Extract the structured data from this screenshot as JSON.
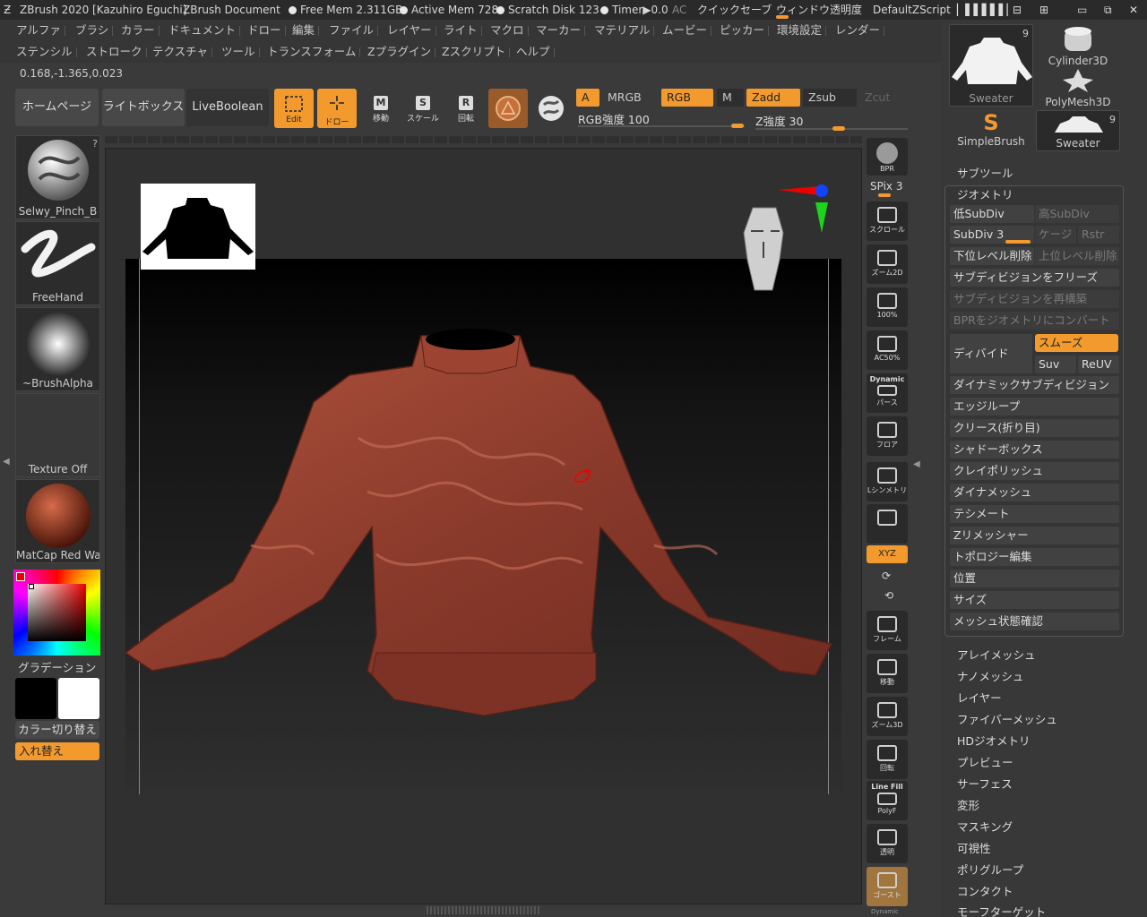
{
  "titlebar": {
    "app": "ZBrush 2020 [Kazuhiro Eguchi]",
    "doc": "ZBrush Document",
    "free_mem": "Free Mem 2.311GB",
    "active_mem": "Active Mem 728",
    "scratch": "Scratch Disk 123",
    "timer": "Timer▶0.0",
    "ac": "AC",
    "quicksave": "クイックセーブ",
    "transparency": "ウィンドウ透明度",
    "script": "DefaultZScript"
  },
  "menu_row1": [
    "アルファ",
    "ブラシ",
    "カラー",
    "ドキュメント",
    "ドロー",
    "編集",
    "ファイル",
    "レイヤー",
    "ライト",
    "マクロ",
    "マーカー",
    "マテリアル",
    "ムービー",
    "ピッカー",
    "環境設定",
    "レンダー"
  ],
  "menu_row2": [
    "ステンシル",
    "ストローク",
    "テクスチャ",
    "ツール",
    "トランスフォーム",
    "Zプラグイン",
    "Zスクリプト",
    "ヘルプ"
  ],
  "coords": "0.168,-1.365,0.023",
  "toolbar": {
    "home": "ホームページ",
    "lightbox": "ライトボックス",
    "liveboolean": "LiveBoolean",
    "edit": "Edit",
    "draw": "ドロー",
    "move": "移動",
    "scale": "スケール",
    "rotate": "回転",
    "a": "A",
    "mrgb": "MRGB",
    "rgb": "RGB",
    "m": "M",
    "zadd": "Zadd",
    "zsub": "Zsub",
    "zcut": "Zcut",
    "rgb_intensity": "RGB強度 100",
    "z_intensity": "Z強度 30"
  },
  "left": {
    "brush": "Selwy_Pinch_B",
    "stroke": "FreeHand",
    "alpha": "~BrushAlpha",
    "texture": "Texture Off",
    "material": "MatCap Red Wax",
    "gradient": "グラデーション",
    "switch_color": "カラー切り替え",
    "swap": "入れ替え",
    "brush_badge": "?"
  },
  "right_shelf": {
    "bpr": "BPR",
    "spix": "SPix 3",
    "scroll": "スクロール",
    "zoom2d": "ズーム2D",
    "p100": "100%",
    "ac50": "AC50%",
    "dynamic": "Dynamic",
    "perspective": "パース",
    "floor": "フロア",
    "lsym": "Lシンメトリ",
    "xyz": "XYZ",
    "frame": "フレーム",
    "move": "移動",
    "zoom3d": "ズーム3D",
    "rotate": "回転",
    "linefill": "Line Fill",
    "polyf": "PolyF",
    "transp": "透明",
    "ghost": "ゴースト",
    "dynamic2": "Dynamic"
  },
  "tools": {
    "sweater": "Sweater",
    "sweater_count": "9",
    "cylinder": "Cylinder3D",
    "polymesh": "PolyMesh3D",
    "simplebrush": "SimpleBrush",
    "sweater2": "Sweater",
    "sweater2_count": "9"
  },
  "geometry": {
    "subtool": "サブツール",
    "header": "ジオメトリ",
    "lower_subdiv": "低SubDiv",
    "higher_subdiv": "高SubDiv",
    "subdiv": "SubDiv 3",
    "cage": "ケージ",
    "rstr": "Rstr",
    "del_lower": "下位レベル削除",
    "del_higher": "上位レベル削除",
    "freeze": "サブディビジョンをフリーズ",
    "reconstruct": "サブディビジョンを再構築",
    "bpr_convert": "BPRをジオメトリにコンバート",
    "divide": "ディバイド",
    "smooth": "スムーズ",
    "suv": "Suv",
    "reuv": "ReUV",
    "items": [
      "ダイナミックサブディビジョン",
      "エッジループ",
      "クリース(折り目)",
      "シャドーボックス",
      "クレイポリッシュ",
      "ダイナメッシュ",
      "テシメート",
      "Zリメッシャー",
      "トポロジー編集",
      "位置",
      "サイズ",
      "メッシュ状態確認"
    ]
  },
  "subpalettes": [
    "アレイメッシュ",
    "ナノメッシュ",
    "レイヤー",
    "ファイバーメッシュ",
    "HDジオメトリ",
    "プレビュー",
    "サーフェス",
    "変形",
    "マスキング",
    "可視性",
    "ポリグループ",
    "コンタクト",
    "モーフターゲット"
  ],
  "colors": {
    "accent": "#f39a2e",
    "model": "#8a3a2b",
    "primary": "#000000",
    "secondary": "#ffffff"
  }
}
